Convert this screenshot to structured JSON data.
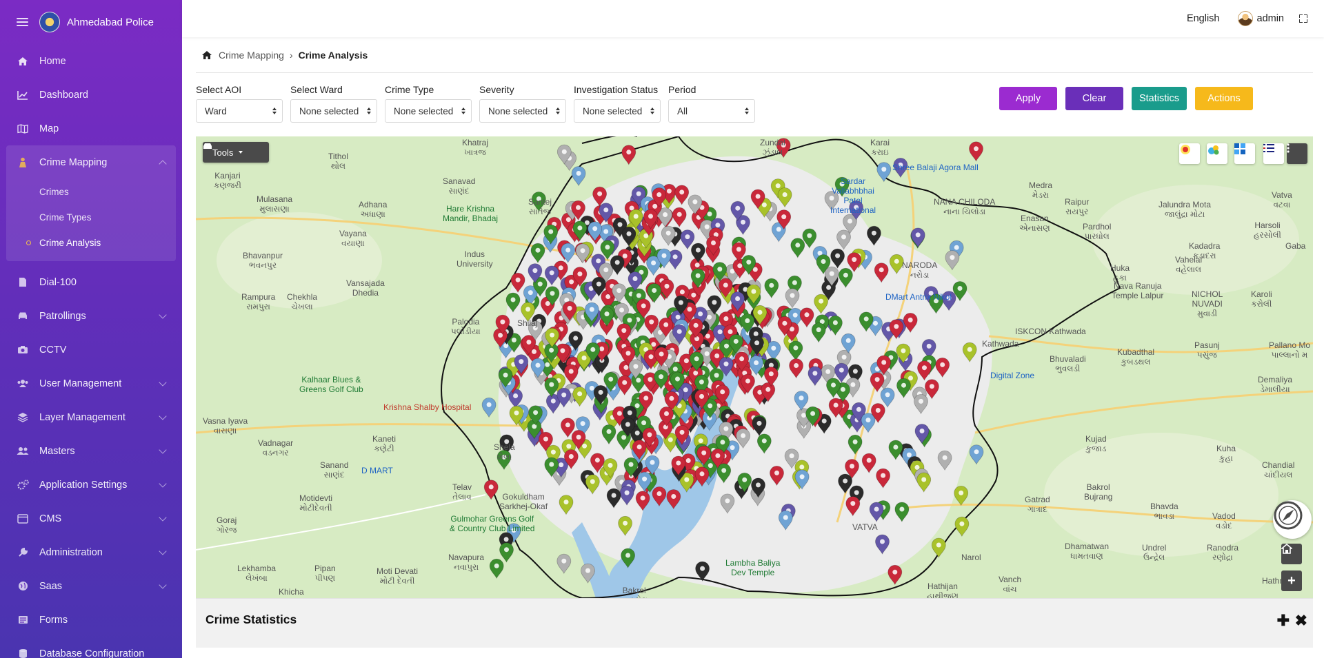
{
  "app": {
    "title": "Ahmedabad Police"
  },
  "topbar": {
    "language": "English",
    "user": "admin"
  },
  "sidebar": {
    "items": [
      {
        "label": "Home",
        "icon": "home-icon"
      },
      {
        "label": "Dashboard",
        "icon": "chart-line-icon"
      },
      {
        "label": "Map",
        "icon": "map-icon"
      },
      {
        "label": "Crime Mapping",
        "icon": "person-icon",
        "expanded": true,
        "children": [
          {
            "label": "Crimes"
          },
          {
            "label": "Crime Types"
          },
          {
            "label": "Crime Analysis",
            "active": true
          }
        ]
      },
      {
        "label": "Dial-100",
        "icon": "file-icon"
      },
      {
        "label": "Patrollings",
        "icon": "car-icon",
        "has_children": true
      },
      {
        "label": "CCTV",
        "icon": "camera-icon"
      },
      {
        "label": "User Management",
        "icon": "users-icon",
        "has_children": true
      },
      {
        "label": "Layer Management",
        "icon": "layers-icon",
        "has_children": true
      },
      {
        "label": "Masters",
        "icon": "user-group-icon",
        "has_children": true
      },
      {
        "label": "Application Settings",
        "icon": "gears-icon",
        "has_children": true
      },
      {
        "label": "CMS",
        "icon": "cms-icon",
        "has_children": true
      },
      {
        "label": "Administration",
        "icon": "wrench-icon",
        "has_children": true
      },
      {
        "label": "Saas",
        "icon": "globe-icon",
        "has_children": true
      },
      {
        "label": "Forms",
        "icon": "form-icon"
      },
      {
        "label": "Database Configuration",
        "icon": "database-icon"
      }
    ]
  },
  "breadcrumb": {
    "parent": "Crime Mapping",
    "current": "Crime Analysis"
  },
  "filters": [
    {
      "label": "Select AOI",
      "value": "Ward"
    },
    {
      "label": "Select Ward",
      "value": "None selected"
    },
    {
      "label": "Crime Type",
      "value": "None selected"
    },
    {
      "label": "Severity",
      "value": "None selected"
    },
    {
      "label": "Investigation Status",
      "value": "None selected"
    },
    {
      "label": "Period",
      "value": "All"
    }
  ],
  "buttons": {
    "apply": "Apply",
    "clear": "Clear",
    "statistics": "Statistics",
    "actions": "Actions"
  },
  "colors": {
    "apply": "#9b2bd0",
    "clear": "#6a2fb9",
    "statistics": "#1a9c8c",
    "actions": "#f6b91b",
    "marker_red": "#c9283a",
    "marker_green": "#3b8e2e",
    "marker_lime": "#a9c22a",
    "marker_blue": "#6fa3d4",
    "marker_purple": "#6357a8",
    "marker_black": "#2b2b2b",
    "marker_grey": "#b0b0b0"
  },
  "map": {
    "tools_label": "Tools",
    "labels": [
      {
        "text": "Khatraj\nખાત્રજ"
      },
      {
        "text": "Tithol\nથોલ"
      },
      {
        "text": "Kanjari\nકણજરી"
      },
      {
        "text": "Sanavad\nસાણંદ"
      },
      {
        "text": "Mulasana\nમુલાસણા"
      },
      {
        "text": "Adhana\nઅધાણા"
      },
      {
        "text": "Hare Krishna\nMandir, Bhadaj"
      },
      {
        "text": "Santej\nસાંતેજ"
      },
      {
        "text": "Vayana\nવયાણા"
      },
      {
        "text": "Bhavanpur\nભવનપુર"
      },
      {
        "text": "Indus\nUniversity"
      },
      {
        "text": "Rampura\nરામપુરા"
      },
      {
        "text": "Chekhla\nચેખલા"
      },
      {
        "text": "Vansajada\nDhedia"
      },
      {
        "text": "Palodia\nપલોડીયા"
      },
      {
        "text": "Shilaj"
      },
      {
        "text": "Kalhaar Blues &\nGreens Golf Club"
      },
      {
        "text": "Krishna Shalby Hospital"
      },
      {
        "text": "Vasna Iyava\nવાસણા"
      },
      {
        "text": "Vadnagar\nવડનગર"
      },
      {
        "text": "Kaneti\nકણેટી"
      },
      {
        "text": "Shela\nશેલા"
      },
      {
        "text": "Sanand\nસાણંદ"
      },
      {
        "text": "D MART"
      },
      {
        "text": "Telav\nતેલાવ"
      },
      {
        "text": "Gokuldham\nSarkhej-Okaf"
      },
      {
        "text": "Gulmohar Greens Golf\n& Country Club Limited"
      },
      {
        "text": "Motidevti\nમોટીદેવતી"
      },
      {
        "text": "Goraj\nગોરજ"
      },
      {
        "text": "Bakrol\nબાકરોલ"
      },
      {
        "text": "Navapura\nનવાપુરા"
      },
      {
        "text": "Lekhamba\nલેખંબા"
      },
      {
        "text": "Khicha"
      },
      {
        "text": "Pipan\nપીપણ"
      },
      {
        "text": "Moti Devati\nમોટી દેવતી"
      },
      {
        "text": "Zundal\nઝુંડાલ"
      },
      {
        "text": "Karai\nકરાઇ"
      },
      {
        "text": "Shree Balaji Agora Mall"
      },
      {
        "text": "Sardar\nVallabhbhai\nPatel\nInternational"
      },
      {
        "text": "NANA CHILODA\nનાના ચિલોડા"
      },
      {
        "text": "Medra\nમેડરા"
      },
      {
        "text": "Raipur\nરાયપુર"
      },
      {
        "text": "Jalundra Mota\nજાલુંદ્રા મોટા"
      },
      {
        "text": "Vatva\nવટવા"
      },
      {
        "text": "Enasan\nએનાસણ"
      },
      {
        "text": "Pardhol\nપારધોલ"
      },
      {
        "text": "Harsoli\nહરસોલી"
      },
      {
        "text": "Kadadra\nકડાદરા"
      },
      {
        "text": "Huka\nહુકા"
      },
      {
        "text": "Vahelal\nવહેલાલ"
      },
      {
        "text": "NARODA\nનરોડા"
      },
      {
        "text": "DMart Antrix Nikol"
      },
      {
        "text": "Nava Ranuja\nTemple Lalpur"
      },
      {
        "text": "NICHOL\nNUVADI\nમુવાડી"
      },
      {
        "text": "Karoli\nકરોલી"
      },
      {
        "text": "ISKCON Kathwada"
      },
      {
        "text": "Kathwada"
      },
      {
        "text": "Bhuvaladi\nભુવલડી"
      },
      {
        "text": "Kubadthal\nકુબડથલ"
      },
      {
        "text": "Pasunj\nપસુંજ"
      },
      {
        "text": "Pallano Mo\nપાલ્લાનો મ"
      },
      {
        "text": "Demaliya\nડેમાલીયા"
      },
      {
        "text": "Digital Zone"
      },
      {
        "text": "Kujad\nકુજાડ"
      },
      {
        "text": "Kuha\nકુહા"
      },
      {
        "text": "Chandial\nચાંદીયલ"
      },
      {
        "text": "Bakrol\nBujrang"
      },
      {
        "text": "Bhavda\nભાવડા"
      },
      {
        "text": "Vadod\nવડોદ"
      },
      {
        "text": "Gatrad\nગાત્રાદ"
      },
      {
        "text": "Dhamatwan\nધામતવાણ"
      },
      {
        "text": "Undrel\nઉન્દ્રેલ"
      },
      {
        "text": "Ranodra\nરણોદ્રા"
      },
      {
        "text": "Hathijan\nહાથીજણ"
      },
      {
        "text": "Vanch\nવાંચ"
      },
      {
        "text": "Lambha Baliya\nDev Temple"
      },
      {
        "text": "VATVA"
      },
      {
        "text": "Narol"
      },
      {
        "text": "Hathne"
      },
      {
        "text": "Gaba"
      }
    ]
  },
  "stats": {
    "title": "Crime Statistics"
  }
}
